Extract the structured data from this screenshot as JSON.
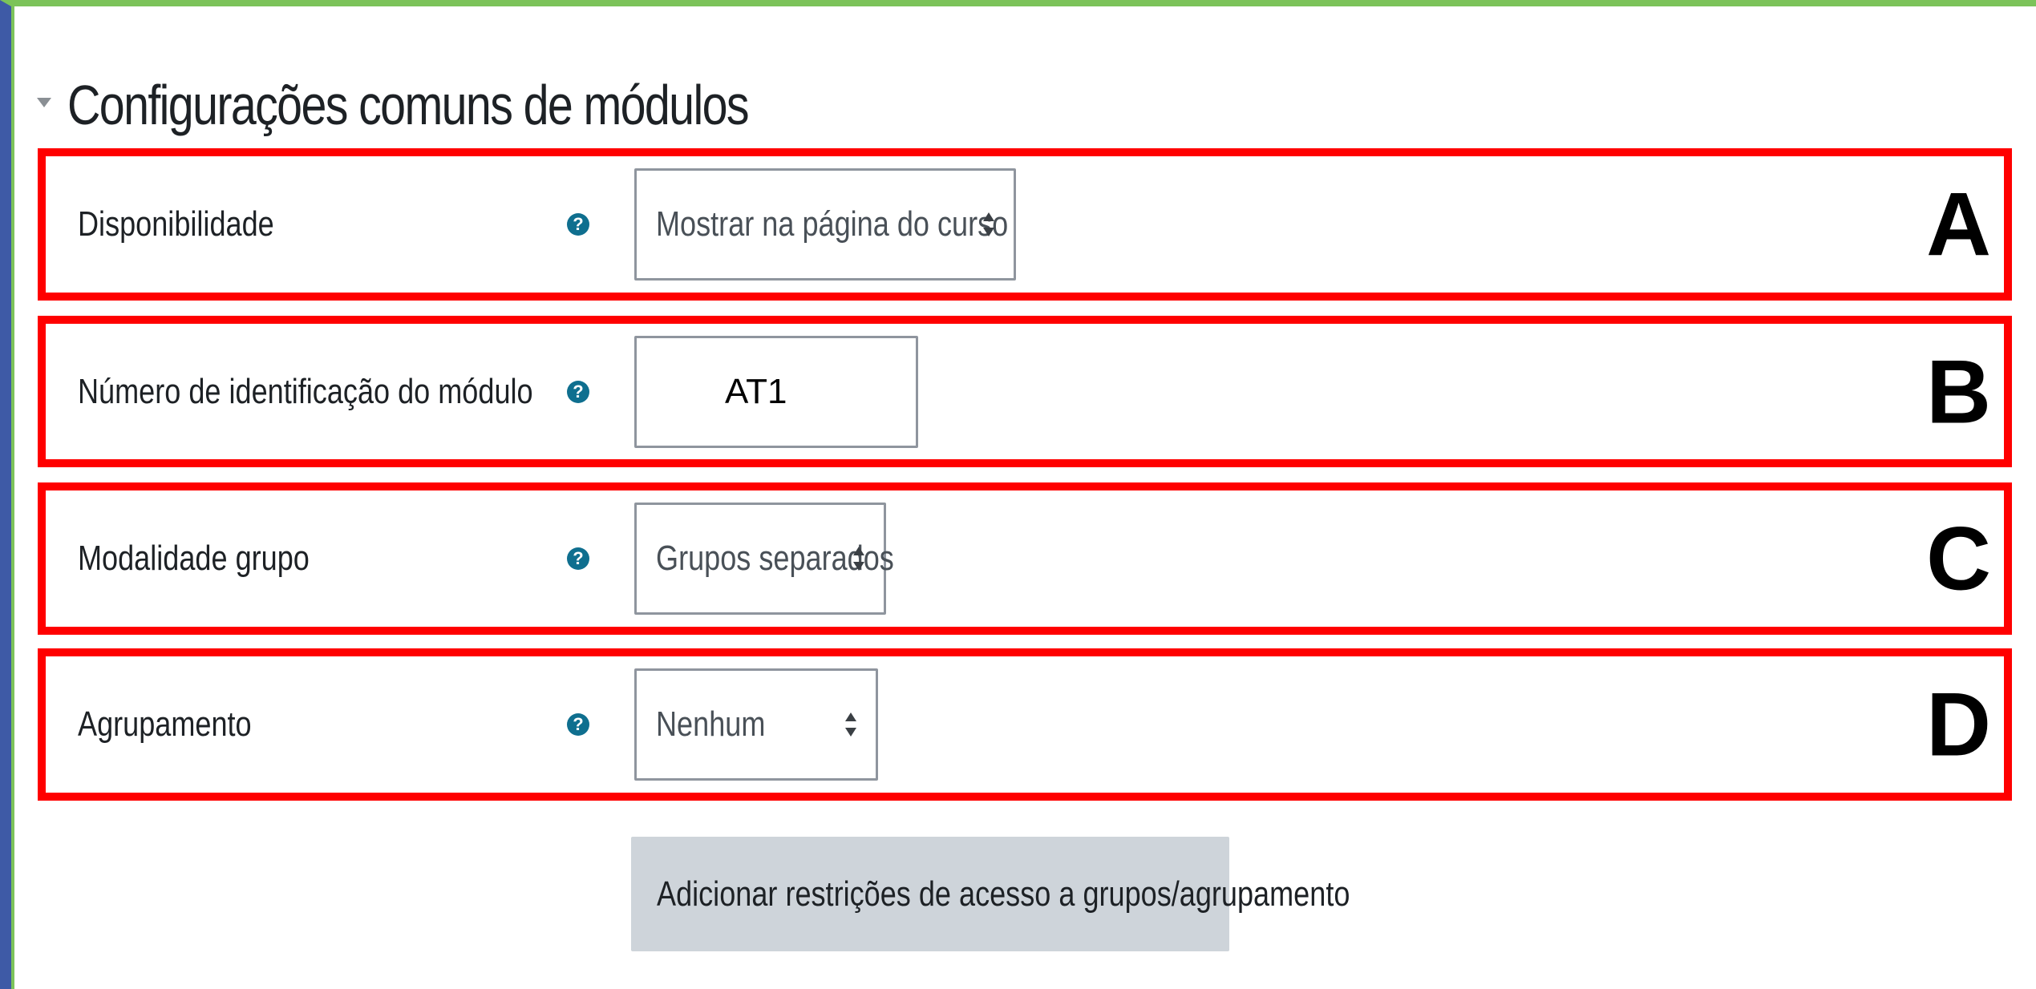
{
  "section": {
    "title": "Configurações comuns de módulos"
  },
  "rows": [
    {
      "label": "Disponibilidade",
      "control_type": "select",
      "value": "Mostrar na página do curso",
      "marker": "A"
    },
    {
      "label": "Número de identificação do módulo",
      "control_type": "text",
      "value": "AT1",
      "marker": "B"
    },
    {
      "label": "Modalidade grupo",
      "control_type": "select",
      "value": "Grupos separados",
      "marker": "C"
    },
    {
      "label": "Agrupamento",
      "control_type": "select",
      "value": "Nenhum",
      "marker": "D"
    }
  ],
  "help_icon": "question-circle-icon",
  "button": {
    "label": "Adicionar restrições de acesso a grupos/agrupamento"
  },
  "colors": {
    "highlight_border": "#ff0000",
    "help_icon": "#0f6f8f",
    "button_bg": "#ced4da",
    "frame_green": "#7cc35a",
    "frame_blue": "#3e5aa6"
  }
}
